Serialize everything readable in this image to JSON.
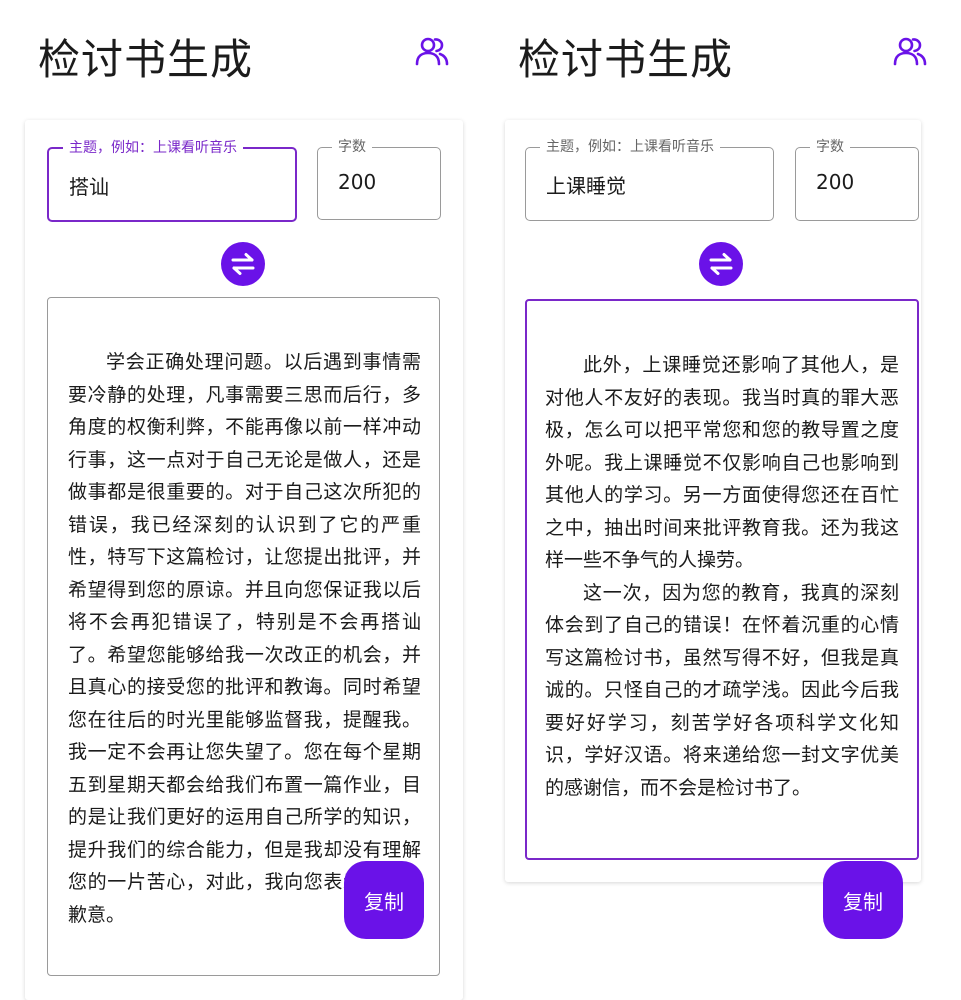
{
  "colors": {
    "accent": "#6a12e8",
    "focus_border": "#7a28c9"
  },
  "icons": {
    "user": "users-icon",
    "swap": "swap-arrows-icon"
  },
  "left": {
    "title": "检讨书生成",
    "topic_label": "主题，例如：上课看听音乐",
    "topic_value": "搭讪",
    "count_label": "字数",
    "count_value": "200",
    "paragraphs": [
      "学会正确处理问题。以后遇到事情需要冷静的处理，凡事需要三思而后行，多角度的权衡利弊，不能再像以前一样冲动行事，这一点对于自己无论是做人，还是做事都是很重要的。对于自己这次所犯的错误，我已经深刻的认识到了它的严重性，特写下这篇检讨，让您提出批评，并希望得到您的原谅。并且向您保证我以后将不会再犯错误了，特别是不会再搭讪了。希望您能够给我一次改正的机会，并且真心的接受您的批评和教诲。同时希望您在往后的时光里能够监督我，提醒我。我一定不会再让您失望了。您在每个星期五到星期天都会给我们布置一篇作业，目的是让我们更好的运用自己所学的知识，提升我们的综合能力，但是我却没有理解您的一片苦心，对此，我向您表示深深的歉意。"
    ],
    "copy_label": "复制"
  },
  "right": {
    "title": "检讨书生成",
    "topic_label": "主题，例如：上课看听音乐",
    "topic_value": "上课睡觉",
    "count_label": "字数",
    "count_value": "200",
    "paragraphs": [
      "此外，上课睡觉还影响了其他人，是对他人不友好的表现。我当时真的罪大恶极，怎么可以把平常您和您的教导置之度外呢。我上课睡觉不仅影响自己也影响到其他人的学习。另一方面使得您还在百忙之中，抽出时间来批评教育我。还为我这样一些不争气的人操劳。",
      "这一次，因为您的教育，我真的深刻体会到了自己的错误！在怀着沉重的心情写这篇检讨书，虽然写得不好，但我是真诚的。只怪自己的才疏学浅。因此今后我要好好学习，刻苦学好各项科学文化知识，学好汉语。将来递给您一封文字优美的感谢信，而不会是检讨书了。"
    ],
    "copy_label": "复制"
  }
}
